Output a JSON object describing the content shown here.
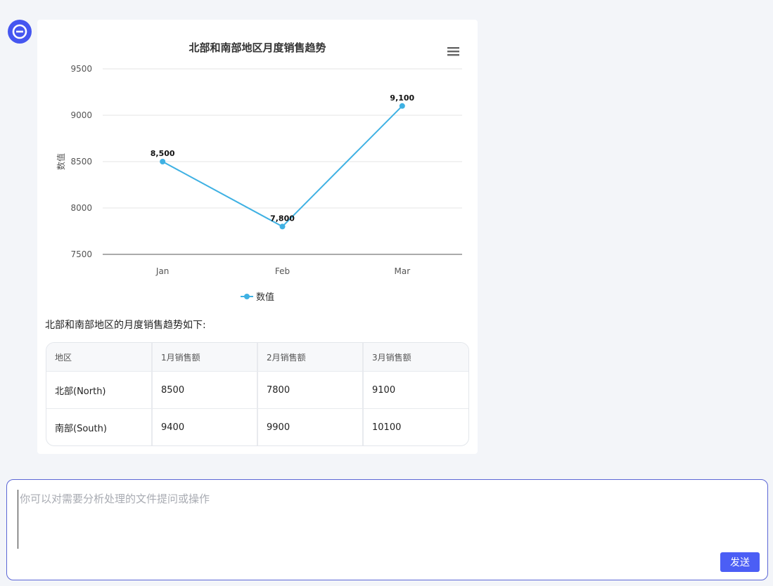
{
  "colors": {
    "accent": "#4556f0",
    "series": "#3fb1e3",
    "send": "#4b5ef5"
  },
  "chart_data": {
    "type": "line",
    "title": "北部和南部地区月度销售趋势",
    "ylabel": "数值",
    "xlabel": "",
    "categories": [
      "Jan",
      "Feb",
      "Mar"
    ],
    "series": [
      {
        "name": "数值",
        "values": [
          8500,
          7800,
          9100
        ],
        "labels": [
          "8,500",
          "7,800",
          "9,100"
        ]
      }
    ],
    "ylim": [
      7500,
      9500
    ],
    "yticks": [
      7500,
      8000,
      8500,
      9000,
      9500
    ],
    "grid": true,
    "legend": "bottom-center"
  },
  "message": {
    "intro": "北部和南部地区的月度销售趋势如下:",
    "table": {
      "headers": [
        "地区",
        "1月销售额",
        "2月销售额",
        "3月销售额"
      ],
      "rows": [
        [
          "北部(North)",
          "8500",
          "7800",
          "9100"
        ],
        [
          "南部(South)",
          "9400",
          "9900",
          "10100"
        ]
      ]
    }
  },
  "input": {
    "placeholder": "你可以对需要分析处理的文件提问或操作",
    "send_label": "发送"
  },
  "icons": {
    "avatar": "logo-e-icon",
    "menu": "menu-icon"
  }
}
